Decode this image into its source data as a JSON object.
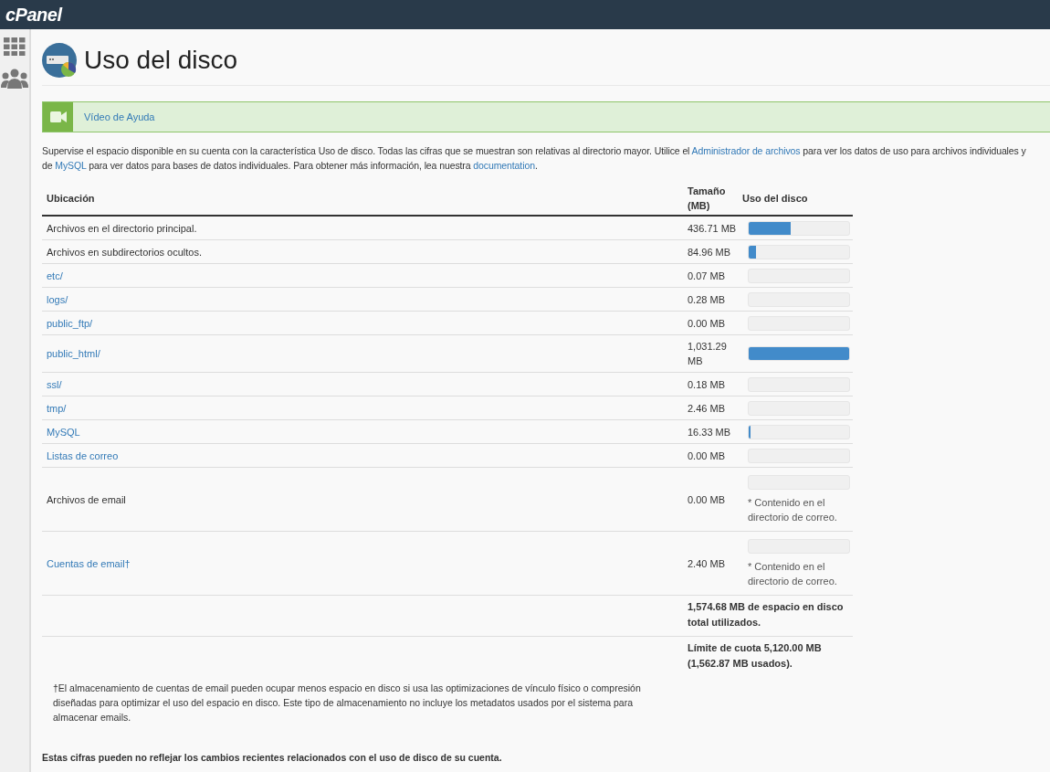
{
  "brand": "cPanel",
  "page_title": "Uso del disco",
  "help_video": {
    "label": "Vídeo de Ayuda"
  },
  "description_lines": [
    [
      {
        "kind": "text",
        "text": "Supervise el espacio disponible en su cuenta con la característica Uso de disco. Todas las cifras que se muestran son relativas al directorio mayor. Utilice el "
      },
      {
        "kind": "link",
        "text": "Administrador de archivos"
      },
      {
        "kind": "text",
        "text": " para ver los datos de uso para archivos individuales y"
      }
    ],
    [
      {
        "kind": "text",
        "text": "de "
      },
      {
        "kind": "link",
        "text": "MySQL"
      },
      {
        "kind": "text",
        "text": " para ver datos para bases de datos individuales. Para obtener más información, lea nuestra "
      },
      {
        "kind": "link",
        "text": "documentation"
      },
      {
        "kind": "text",
        "text": "."
      }
    ]
  ],
  "table": {
    "columns": [
      "Ubicación",
      "Tamaño (MB)",
      "Uso del disco"
    ],
    "rows": [
      {
        "kind": "text",
        "location": "Archivos en el directorio principal.",
        "size": "436.71 MB",
        "level": 0.42
      },
      {
        "kind": "text",
        "location": "Archivos en subdirectorios ocultos.",
        "size": "84.96 MB",
        "level": 0.07
      },
      {
        "kind": "link",
        "location": "etc/",
        "size": "0.07 MB",
        "level": 0
      },
      {
        "kind": "link",
        "location": "logs/",
        "size": "0.28 MB",
        "level": 0
      },
      {
        "kind": "link",
        "location": "public_ftp/",
        "size": "0.00 MB",
        "level": 0
      },
      {
        "kind": "link",
        "location": "public_html/",
        "size": "1,031.29 MB",
        "level": 1
      },
      {
        "kind": "link",
        "location": "ssl/",
        "size": "0.18 MB",
        "level": 0
      },
      {
        "kind": "link",
        "location": "tmp/",
        "size": "2.46 MB",
        "level": 0
      },
      {
        "kind": "link",
        "location": "MySQL",
        "size": "16.33 MB",
        "level": 0.02
      },
      {
        "kind": "link",
        "location": "Listas de correo",
        "size": "0.00 MB",
        "level": 0
      },
      {
        "kind": "text",
        "location": "Archivos de email",
        "size": "0.00 MB",
        "level": 0,
        "note": "* Contenido en el directorio de correo."
      },
      {
        "kind": "link",
        "location": "Cuentas de email†",
        "size": "2.40 MB",
        "level": 0,
        "note": "* Contenido en el directorio de correo."
      }
    ],
    "total": "1,574.68 MB de espacio en disco total utilizados.",
    "quota": "Límite de cuota 5,120.00 MB (1,562.87 MB usados)."
  },
  "footnote": "†El almacenamiento de cuentas de email pueden ocupar menos espacio en disco si usa las optimizaciones de vínculo físico o compresión diseñadas para optimizar el uso del espacio en disco. Este tipo de almacenamiento no incluye los metadatos usados por el sistema para almacenar emails.",
  "disclaimer": "Estas cifras pueden no reflejar los cambios recientes relacionados con el uso de disco de su cuenta."
}
